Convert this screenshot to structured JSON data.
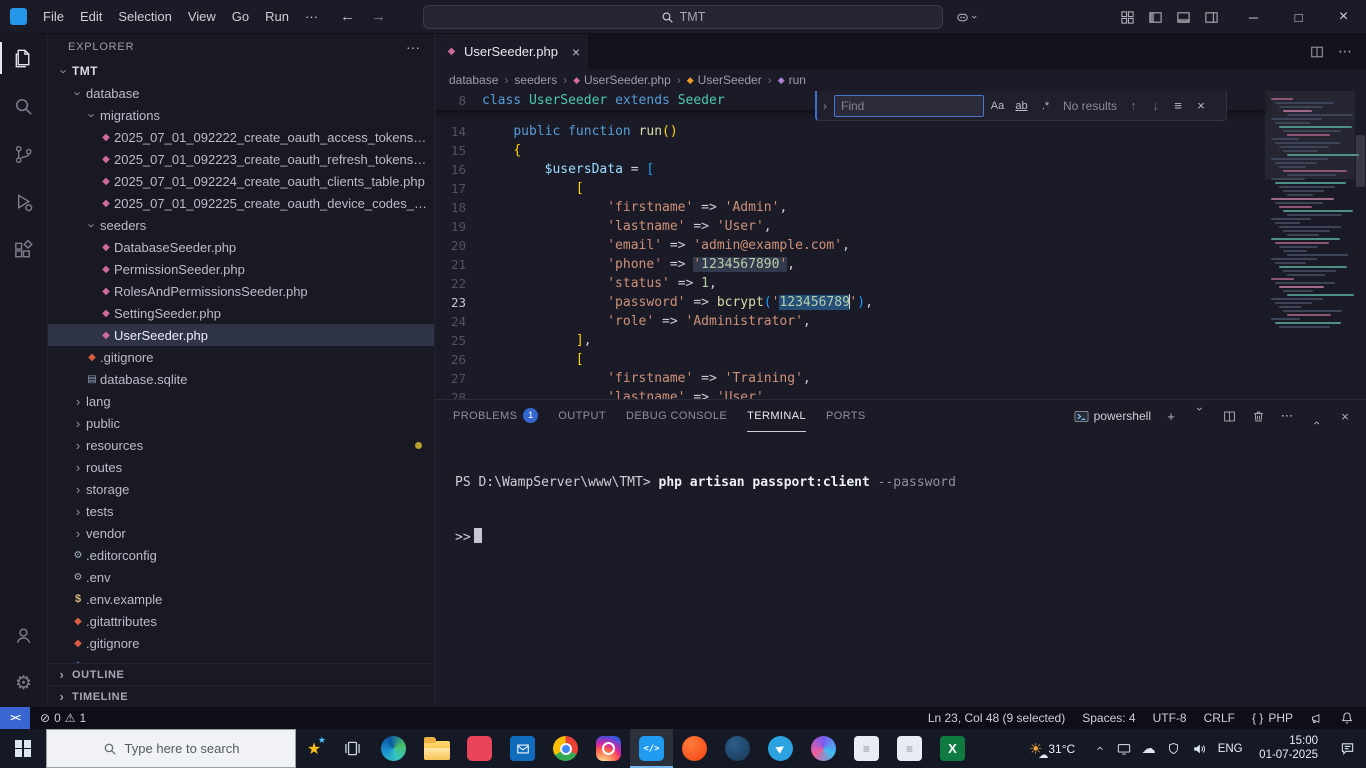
{
  "titlebar": {
    "menus": [
      "File",
      "Edit",
      "Selection",
      "View",
      "Go",
      "Run",
      "···"
    ],
    "back": "←",
    "forward": "→",
    "search_text": "TMT",
    "window": {
      "minimize": "─",
      "maximize": "□",
      "close": "×"
    }
  },
  "activitybar": {
    "items": [
      {
        "name": "explorer",
        "active": true
      },
      {
        "name": "search",
        "active": false
      },
      {
        "name": "source-control",
        "active": false
      },
      {
        "name": "run-debug",
        "active": false
      },
      {
        "name": "extensions",
        "active": false
      }
    ],
    "bottom": [
      {
        "name": "accounts"
      },
      {
        "name": "settings"
      }
    ]
  },
  "explorer": {
    "header": "EXPLORER",
    "header_actions": "···",
    "tree": [
      {
        "label": "TMT",
        "depth": 0,
        "type": "root",
        "expanded": true
      },
      {
        "label": "database",
        "depth": 1,
        "type": "folder",
        "expanded": true
      },
      {
        "label": "migrations",
        "depth": 2,
        "type": "folder",
        "expanded": true
      },
      {
        "label": "2025_07_01_092222_create_oauth_access_tokens_table.php",
        "depth": 3,
        "type": "file",
        "icon": "php"
      },
      {
        "label": "2025_07_01_092223_create_oauth_refresh_tokens_table.php",
        "depth": 3,
        "type": "file",
        "icon": "php"
      },
      {
        "label": "2025_07_01_092224_create_oauth_clients_table.php",
        "depth": 3,
        "type": "file",
        "icon": "php"
      },
      {
        "label": "2025_07_01_092225_create_oauth_device_codes_table.php",
        "depth": 3,
        "type": "file",
        "icon": "php"
      },
      {
        "label": "seeders",
        "depth": 2,
        "type": "folder",
        "expanded": true
      },
      {
        "label": "DatabaseSeeder.php",
        "depth": 3,
        "type": "file",
        "icon": "php"
      },
      {
        "label": "PermissionSeeder.php",
        "depth": 3,
        "type": "file",
        "icon": "php"
      },
      {
        "label": "RolesAndPermissionsSeeder.php",
        "depth": 3,
        "type": "file",
        "icon": "php"
      },
      {
        "label": "SettingSeeder.php",
        "depth": 3,
        "type": "file",
        "icon": "php"
      },
      {
        "label": "UserSeeder.php",
        "depth": 3,
        "type": "file",
        "icon": "php",
        "selected": true
      },
      {
        "label": ".gitignore",
        "depth": 2,
        "type": "file",
        "icon": "git"
      },
      {
        "label": "database.sqlite",
        "depth": 2,
        "type": "file",
        "icon": "db"
      },
      {
        "label": "lang",
        "depth": 1,
        "type": "folder",
        "expanded": false
      },
      {
        "label": "public",
        "depth": 1,
        "type": "folder",
        "expanded": false
      },
      {
        "label": "resources",
        "depth": 1,
        "type": "folder",
        "expanded": false,
        "dot": true
      },
      {
        "label": "routes",
        "depth": 1,
        "type": "folder",
        "expanded": false
      },
      {
        "label": "storage",
        "depth": 1,
        "type": "folder",
        "expanded": false
      },
      {
        "label": "tests",
        "depth": 1,
        "type": "folder",
        "expanded": false
      },
      {
        "label": "vendor",
        "depth": 1,
        "type": "folder",
        "expanded": false
      },
      {
        "label": ".editorconfig",
        "depth": 1,
        "type": "file",
        "icon": "config"
      },
      {
        "label": ".env",
        "depth": 1,
        "type": "file",
        "icon": "gear"
      },
      {
        "label": ".env.example",
        "depth": 1,
        "type": "file",
        "icon": "dollar"
      },
      {
        "label": ".gitattributes",
        "depth": 1,
        "type": "file",
        "icon": "git"
      },
      {
        "label": ".gitignore",
        "depth": 1,
        "type": "file",
        "icon": "git"
      },
      {
        "label": "",
        "depth": 1,
        "type": "file",
        "icon": "md"
      }
    ],
    "sections": [
      {
        "label": "OUTLINE"
      },
      {
        "label": "TIMELINE"
      }
    ]
  },
  "editor": {
    "tab": {
      "label": "UserSeeder.php",
      "close": "×"
    },
    "breadcrumbs": [
      {
        "label": "database",
        "icon": ""
      },
      {
        "label": "seeders",
        "icon": ""
      },
      {
        "label": "UserSeeder.php",
        "icon": "file"
      },
      {
        "label": "UserSeeder",
        "icon": "class"
      },
      {
        "label": "run",
        "icon": "method"
      }
    ],
    "sticky_line": {
      "n": "8",
      "tokens": [
        [
          "kw",
          "class"
        ],
        [
          "pl",
          " "
        ],
        [
          "cl",
          "UserSeeder"
        ],
        [
          "pl",
          " "
        ],
        [
          "kw",
          "extends"
        ],
        [
          "pl",
          " "
        ],
        [
          "cl",
          "Seeder"
        ]
      ]
    },
    "lines": [
      {
        "n": 14,
        "tokens": [
          [
            "pl",
            "    "
          ],
          [
            "kw",
            "public"
          ],
          [
            "pl",
            " "
          ],
          [
            "kw",
            "function"
          ],
          [
            "pl",
            " "
          ],
          [
            "fn",
            "run"
          ],
          [
            "b1",
            "()"
          ]
        ]
      },
      {
        "n": 15,
        "tokens": [
          [
            "pl",
            "    "
          ],
          [
            "b1",
            "{"
          ]
        ]
      },
      {
        "n": 16,
        "tokens": [
          [
            "pl",
            "        "
          ],
          [
            "va",
            "$usersData"
          ],
          [
            "pl",
            " "
          ],
          [
            "op",
            "="
          ],
          [
            "pl",
            " "
          ],
          [
            "b3",
            "["
          ]
        ]
      },
      {
        "n": 17,
        "tokens": [
          [
            "pl",
            "            "
          ],
          [
            "b1",
            "["
          ]
        ]
      },
      {
        "n": 18,
        "tokens": [
          [
            "pl",
            "                "
          ],
          [
            "st",
            "'firstname'"
          ],
          [
            "pl",
            " "
          ],
          [
            "op",
            "=>"
          ],
          [
            "pl",
            " "
          ],
          [
            "st",
            "'Admin'"
          ],
          [
            "pl",
            ","
          ]
        ]
      },
      {
        "n": 19,
        "tokens": [
          [
            "pl",
            "                "
          ],
          [
            "st",
            "'lastname'"
          ],
          [
            "pl",
            " "
          ],
          [
            "op",
            "=>"
          ],
          [
            "pl",
            " "
          ],
          [
            "st",
            "'User'"
          ],
          [
            "pl",
            ","
          ]
        ]
      },
      {
        "n": 20,
        "tokens": [
          [
            "pl",
            "                "
          ],
          [
            "st",
            "'email'"
          ],
          [
            "pl",
            " "
          ],
          [
            "op",
            "=>"
          ],
          [
            "pl",
            " "
          ],
          [
            "st",
            "'admin@example.com'"
          ],
          [
            "pl",
            ","
          ]
        ]
      },
      {
        "n": 21,
        "tokens": [
          [
            "pl",
            "                "
          ],
          [
            "st",
            "'phone'"
          ],
          [
            "pl",
            " "
          ],
          [
            "op",
            "=>"
          ],
          [
            "pl",
            " "
          ],
          [
            "st match",
            "'"
          ],
          [
            "nu match",
            "1234567890"
          ],
          [
            "st match",
            "'"
          ],
          [
            "pl",
            ","
          ]
        ]
      },
      {
        "n": 22,
        "tokens": [
          [
            "pl",
            "                "
          ],
          [
            "st",
            "'status'"
          ],
          [
            "pl",
            " "
          ],
          [
            "op",
            "=>"
          ],
          [
            "pl",
            " "
          ],
          [
            "nu",
            "1"
          ],
          [
            "pl",
            ","
          ]
        ]
      },
      {
        "n": 23,
        "active": true,
        "tokens": [
          [
            "pl",
            "                "
          ],
          [
            "st",
            "'password'"
          ],
          [
            "pl",
            " "
          ],
          [
            "op",
            "=>"
          ],
          [
            "pl",
            " "
          ],
          [
            "fn",
            "bcrypt"
          ],
          [
            "b3",
            "("
          ],
          [
            "st",
            "'"
          ],
          [
            "nu sel",
            "123456789"
          ],
          [
            "caret",
            ""
          ],
          [
            "st",
            "'"
          ],
          [
            "b3",
            ")"
          ],
          [
            "pl",
            ","
          ]
        ]
      },
      {
        "n": 24,
        "tokens": [
          [
            "pl",
            "                "
          ],
          [
            "st",
            "'role'"
          ],
          [
            "pl",
            " "
          ],
          [
            "op",
            "=>"
          ],
          [
            "pl",
            " "
          ],
          [
            "st",
            "'Administrator'"
          ],
          [
            "pl",
            ","
          ]
        ]
      },
      {
        "n": 25,
        "tokens": [
          [
            "pl",
            "            "
          ],
          [
            "b1",
            "]"
          ],
          [
            "pl",
            ","
          ]
        ]
      },
      {
        "n": 26,
        "tokens": [
          [
            "pl",
            "            "
          ],
          [
            "b1",
            "["
          ]
        ]
      },
      {
        "n": 27,
        "tokens": [
          [
            "pl",
            "                "
          ],
          [
            "st",
            "'firstname'"
          ],
          [
            "pl",
            " "
          ],
          [
            "op",
            "=>"
          ],
          [
            "pl",
            " "
          ],
          [
            "st",
            "'Training'"
          ],
          [
            "pl",
            ","
          ]
        ]
      },
      {
        "n": 28,
        "tokens": [
          [
            "pl",
            "                "
          ],
          [
            "st",
            "'lastname'"
          ],
          [
            "pl",
            " "
          ],
          [
            "op",
            "=>"
          ],
          [
            "pl",
            " "
          ],
          [
            "st",
            "'User'"
          ],
          [
            "pl",
            ","
          ]
        ]
      }
    ],
    "find": {
      "placeholder": "Find",
      "results": "No results",
      "buttons": {
        "match_case": "Aa",
        "whole_word": "ab",
        "regex": ".*"
      }
    }
  },
  "panel": {
    "tabs": [
      {
        "label": "PROBLEMS",
        "badge": "1",
        "active": false
      },
      {
        "label": "OUTPUT",
        "active": false
      },
      {
        "label": "DEBUG CONSOLE",
        "active": false
      },
      {
        "label": "TERMINAL",
        "active": true
      },
      {
        "label": "PORTS",
        "active": false
      }
    ],
    "shell_label": "powershell",
    "terminal": {
      "prompt": "PS D:\\WampServer\\www\\TMT>",
      "command": "php artisan passport:client",
      "flag": "--password",
      "continuation": ">>"
    }
  },
  "statusbar": {
    "errors": "0",
    "warnings": "1",
    "right": [
      {
        "name": "cursor-position",
        "label": "Ln 23, Col 48 (9 selected)"
      },
      {
        "name": "indentation",
        "label": "Spaces: 4"
      },
      {
        "name": "encoding",
        "label": "UTF-8"
      },
      {
        "name": "eol",
        "label": "CRLF"
      },
      {
        "name": "language",
        "label": "PHP",
        "icon": "{ }"
      }
    ]
  },
  "taskbar": {
    "search_placeholder": "Type here to search",
    "apps": [
      {
        "name": "edge",
        "style": "edge"
      },
      {
        "name": "file-explorer",
        "style": "folder"
      },
      {
        "name": "app-red",
        "style": "red"
      },
      {
        "name": "mail",
        "style": "mail"
      },
      {
        "name": "chrome",
        "style": "chrome"
      },
      {
        "name": "instagram",
        "style": "insta"
      },
      {
        "name": "vs-code",
        "style": "vscode",
        "glyph": "</>",
        "active": true
      },
      {
        "name": "brave",
        "style": "brave"
      },
      {
        "name": "app-navy",
        "style": "navy"
      },
      {
        "name": "telegram",
        "style": "telegram",
        "glyph": "▶"
      },
      {
        "name": "browser",
        "style": "browser"
      },
      {
        "name": "app-light",
        "style": "light",
        "glyph": "≡"
      },
      {
        "name": "app-light-2",
        "style": "light",
        "glyph": "≡"
      },
      {
        "name": "excel",
        "style": "excel",
        "glyph": "X"
      }
    ],
    "weather": "31°C",
    "language": "ENG",
    "time": "15:00",
    "date": "01-07-2025"
  }
}
